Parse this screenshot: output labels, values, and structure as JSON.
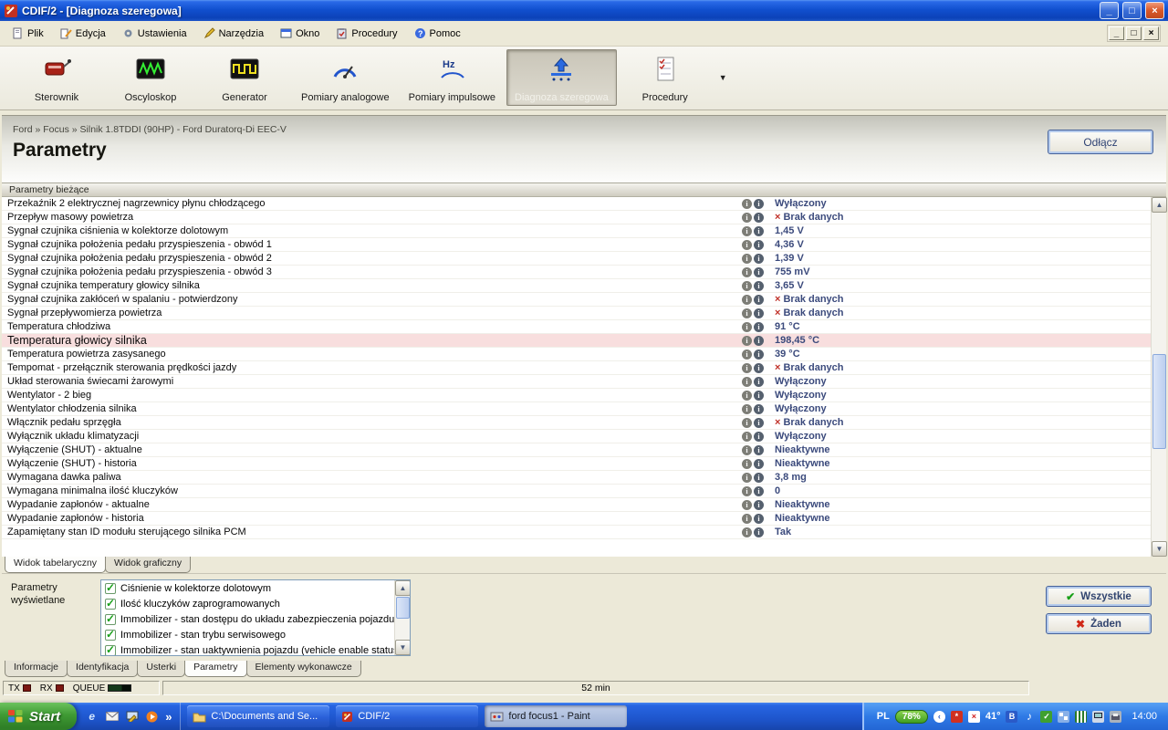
{
  "window": {
    "title": "CDIF/2 - [Diagnoza szeregowa]"
  },
  "menu": [
    "Plik",
    "Edycja",
    "Ustawienia",
    "Narzędzia",
    "Okno",
    "Procedury",
    "Pomoc"
  ],
  "icons": {
    "minimize": "_",
    "maximize": "□",
    "close": "×",
    "mdi_minimize": "_",
    "mdi_restore": "□",
    "mdi_close": "×",
    "param_log": "i",
    "param_info": "i",
    "dropdown_arrow": "▼",
    "scroll_up": "▲",
    "scroll_down": "▼",
    "all_check": "✔",
    "none_x": "✖",
    "quick_launch_overflow": "»",
    "tray_collapse": "‹"
  },
  "toolbar": {
    "items": [
      {
        "label": "Sterownik",
        "icon": "controller-icon",
        "active": false
      },
      {
        "label": "Oscyloskop",
        "icon": "oscilloscope-icon",
        "active": false
      },
      {
        "label": "Generator",
        "icon": "generator-icon",
        "active": false
      },
      {
        "label": "Pomiary analogowe",
        "icon": "analog-gauge-icon",
        "active": false
      },
      {
        "label": "Pomiary impulsowe",
        "icon": "impulse-hz-icon",
        "active": false
      },
      {
        "label": "Diagnoza szeregowa",
        "icon": "serial-diagnosis-icon",
        "active": true
      },
      {
        "label": "Procedury",
        "icon": "procedures-icon",
        "active": false
      }
    ]
  },
  "page": {
    "breadcrumb": "Ford » Focus » Silnik 1.8TDDI (90HP) - Ford Duratorq-Di EEC-V",
    "title": "Parametry",
    "disconnect_button": "Odłącz",
    "section_header": "Parametry bieżące"
  },
  "parameters": [
    {
      "name": "Przekaźnik 2 elektrycznej nagrzewnicy płynu chłodzącego",
      "value": "Wyłączony"
    },
    {
      "name": "Przepływ masowy powietrza",
      "value": "Brak danych",
      "no_data": true
    },
    {
      "name": "Sygnał czujnika ciśnienia w kolektorze dolotowym",
      "value": "1,45 V"
    },
    {
      "name": "Sygnał czujnika położenia pedału przyspieszenia - obwód 1",
      "value": "4,36 V"
    },
    {
      "name": "Sygnał czujnika położenia pedału przyspieszenia - obwód 2",
      "value": "1,39 V"
    },
    {
      "name": "Sygnał czujnika położenia pedału przyspieszenia - obwód 3",
      "value": "755 mV"
    },
    {
      "name": "Sygnał czujnika temperatury głowicy silnika",
      "value": "3,65 V"
    },
    {
      "name": "Sygnał czujnika zakłóceń w spalaniu - potwierdzony",
      "value": "Brak danych",
      "no_data": true
    },
    {
      "name": "Sygnał przepływomierza powietrza",
      "value": "Brak danych",
      "no_data": true
    },
    {
      "name": "Temperatura chłodziwa",
      "value": "91 °C"
    },
    {
      "name": "Temperatura głowicy silnika",
      "value": "198,45 °C",
      "highlight": true
    },
    {
      "name": "Temperatura powietrza zasysanego",
      "value": "39 °C"
    },
    {
      "name": "Tempomat - przełącznik sterowania prędkości jazdy",
      "value": "Brak danych",
      "no_data": true
    },
    {
      "name": "Układ sterowania świecami żarowymi",
      "value": "Wyłączony"
    },
    {
      "name": "Wentylator - 2 bieg",
      "value": "Wyłączony"
    },
    {
      "name": "Wentylator chłodzenia silnika",
      "value": "Wyłączony"
    },
    {
      "name": "Włącznik pedału sprzęgła",
      "value": "Brak danych",
      "no_data": true
    },
    {
      "name": "Wyłącznik układu klimatyzacji",
      "value": "Wyłączony"
    },
    {
      "name": "Wyłączenie (SHUT) - aktualne",
      "value": "Nieaktywne"
    },
    {
      "name": "Wyłączenie (SHUT) - historia",
      "value": "Nieaktywne"
    },
    {
      "name": "Wymagana dawka paliwa",
      "value": "3,8 mg"
    },
    {
      "name": "Wymagana minimalna ilość kluczyków",
      "value": "0"
    },
    {
      "name": "Wypadanie zapłonów - aktualne",
      "value": "Nieaktywne"
    },
    {
      "name": "Wypadanie zapłonów - historia",
      "value": "Nieaktywne"
    },
    {
      "name": "Zapamiętany stan ID modułu sterującego silnika PCM",
      "value": "Tak"
    }
  ],
  "view_tabs": [
    {
      "label": "Widok tabelaryczny",
      "active": true
    },
    {
      "label": "Widok graficzny",
      "active": false
    }
  ],
  "display_panel": {
    "label": "Parametry wyświetlane",
    "options": [
      "Ciśnienie w kolektorze dolotowym",
      "Ilość kluczyków zaprogramowanych",
      "Immobilizer - stan dostępu do układu zabezpieczenia pojazdu",
      "Immobilizer - stan trybu serwisowego",
      "Immobilizer - stan uaktywnienia pojazdu (vehicle enable status)"
    ],
    "all_button": "Wszystkie",
    "none_button": "Żaden"
  },
  "bottom_tabs": [
    {
      "label": "Informacje",
      "active": false
    },
    {
      "label": "Identyfikacja",
      "active": false
    },
    {
      "label": "Usterki",
      "active": false
    },
    {
      "label": "Parametry",
      "active": true
    },
    {
      "label": "Elementy wykonawcze",
      "active": false
    }
  ],
  "status": {
    "tx": "TX",
    "rx": "RX",
    "queue": "QUEUE",
    "session_time": "52 min"
  },
  "taskbar": {
    "start_label": "Start",
    "windows": [
      {
        "title": "C:\\Documents and Se...",
        "icon": "folder-icon",
        "pressed": false
      },
      {
        "title": "CDIF/2",
        "icon": "cdif-app-icon",
        "pressed": false
      },
      {
        "title": "ford focus1 - Paint",
        "icon": "paint-icon",
        "pressed": true
      }
    ],
    "tray": {
      "language": "PL",
      "battery": "78%",
      "temperature": "41°",
      "clock": "14:00"
    }
  }
}
